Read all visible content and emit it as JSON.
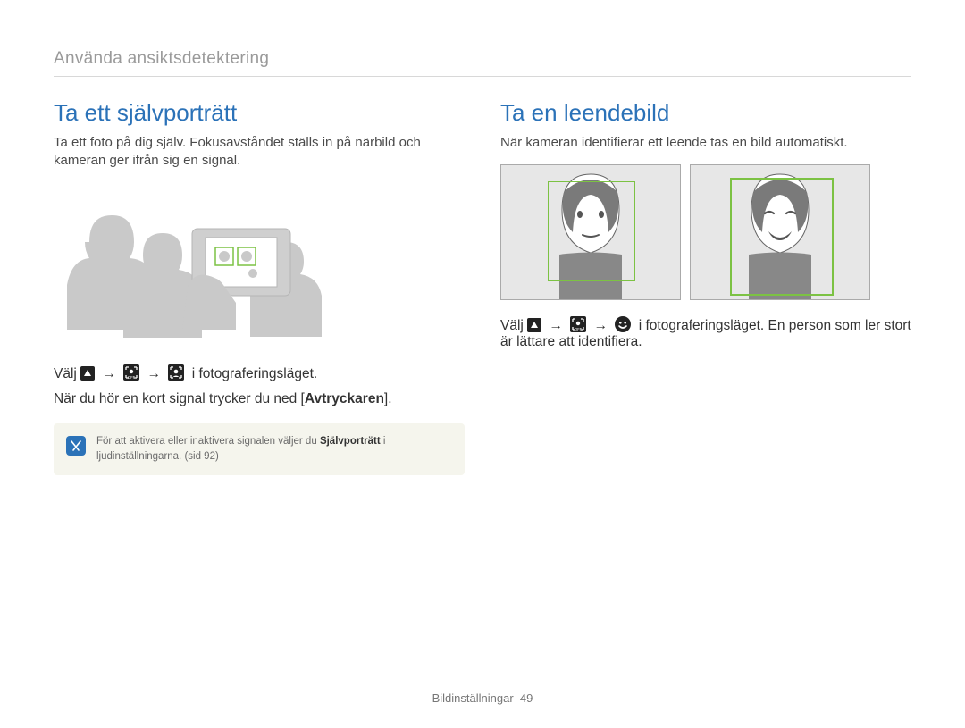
{
  "breadcrumb": "Använda ansiktsdetektering",
  "left": {
    "title": "Ta ett självporträtt",
    "intro": "Ta ett foto på dig själv. Fokusavståndet ställs in på närbild och kameran ger ifrån sig en signal.",
    "step1_prefix": "Välj",
    "step1_suffix": "i fotograferingsläget.",
    "step2_pre": "När du hör en kort signal trycker du ned [",
    "step2_strong": "Avtryckaren",
    "step2_post": "].",
    "note_pre": "För att aktivera eller inaktivera signalen väljer du ",
    "note_strong": "Självporträtt",
    "note_post": " i ljudinställningarna. (sid 92)"
  },
  "right": {
    "title": "Ta en leendebild",
    "intro": "När kameran identifierar ett leende tas en bild automatiskt.",
    "step_prefix": "Välj",
    "step_suffix": "i fotograferingsläget. En person som ler stort är lättare att identifiera."
  },
  "icons": {
    "arrow": "→",
    "up_name": "up-triangle-icon",
    "face_off_name": "face-detect-off-icon",
    "self_portrait_name": "self-portrait-icon",
    "smile_name": "smile-shot-icon"
  },
  "footer": {
    "label": "Bildinställningar",
    "page": "49"
  }
}
